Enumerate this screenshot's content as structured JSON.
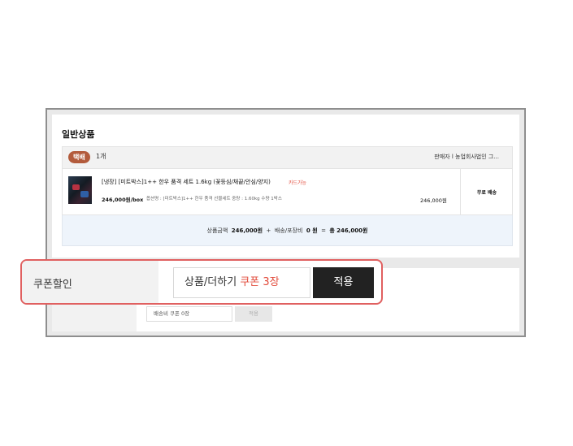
{
  "section": {
    "title": "일반상품"
  },
  "group": {
    "badge": "택배",
    "count": "1개",
    "seller": "판매자  l 농업회사법인 그..."
  },
  "item": {
    "name": "[냉장] [미트박스]1++ 한우 품격 세트 1.6kg (꽃등심/채끝/안심/양지)",
    "card_note": "카드가능",
    "unit_price": "246,000원/box",
    "option_info": "옵션명 : [미트박스]1++ 한우 품격 선물세트    중량 : 1.60kg    수량 1박스",
    "total": "246,000원",
    "shipping": "무료 배송"
  },
  "summary": {
    "product_label": "상품금액",
    "product_amount": "246,000원",
    "plus": "+",
    "ship_label": "배송/포장비",
    "ship_amount": "0 원",
    "equals": "=",
    "total_label": "총",
    "total_amount": "246,000원"
  },
  "coupon": {
    "label": "쿠폰할인",
    "field_text": "상품/더하기",
    "field_count": "쿠폰 3장",
    "apply_label": "적용"
  },
  "shipping_coupon": {
    "field_text": "배송비 쿠폰 0장",
    "apply_label": "적용"
  },
  "colors": {
    "badge": "#b35b3c",
    "accent_red": "#e24b3b",
    "callout_border": "#e06060",
    "apply_button": "#222222",
    "summary_bg": "#eef4fb"
  }
}
